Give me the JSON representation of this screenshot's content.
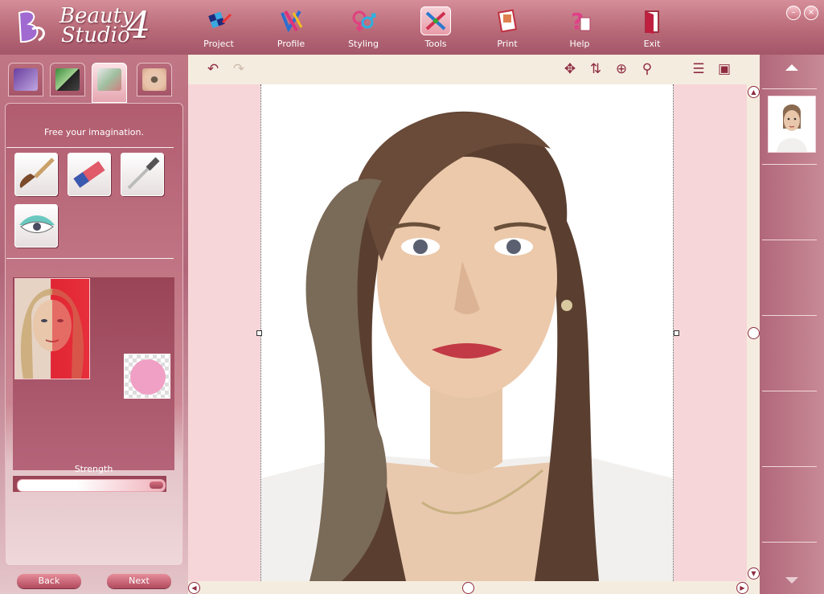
{
  "app": {
    "logo_line1": "Beauty",
    "logo_line2": "Studio",
    "logo_version": "4"
  },
  "nav": [
    {
      "label": "Project",
      "icon": "project-icon"
    },
    {
      "label": "Profile",
      "icon": "profile-icon"
    },
    {
      "label": "Styling",
      "icon": "styling-icon"
    },
    {
      "label": "Tools",
      "icon": "tools-icon",
      "active": true
    },
    {
      "label": "Print",
      "icon": "print-icon"
    },
    {
      "label": "Help",
      "icon": "help-icon"
    },
    {
      "label": "Exit",
      "icon": "exit-icon"
    }
  ],
  "window": {
    "minimize": "–",
    "close": "×"
  },
  "left_panel": {
    "tabs": [
      "hair-color-tab",
      "makeup-tab",
      "tools-tab",
      "eyes-tab"
    ],
    "caption": "Free your imagination.",
    "tools": [
      "brush-tool",
      "eraser-tool",
      "dropper-tool",
      "eye-shadow-tool"
    ],
    "strength_label": "Strength",
    "strength_value": 0.97,
    "swatch_color": "#f0a0c4",
    "back_label": "Back",
    "next_label": "Next"
  },
  "toolbar": {
    "undo": "↶",
    "redo": "↷",
    "move": "✥",
    "rotate": "⇅",
    "target": "⊕",
    "zoom": "⚲",
    "menu": "☰",
    "camera": "▣"
  },
  "colors": {
    "accent": "#b86a78",
    "canvas_bg": "#f7d6d9",
    "toolbar_bg": "#f5ece0"
  }
}
